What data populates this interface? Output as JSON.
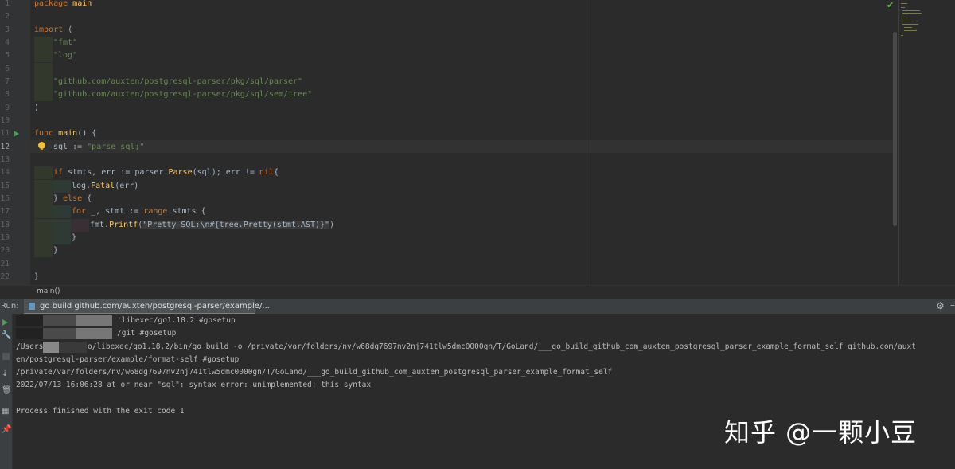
{
  "editor": {
    "line_numbers": [
      "1",
      "2",
      "3",
      "4",
      "5",
      "6",
      "7",
      "8",
      "9",
      "10",
      "11",
      "12",
      "13",
      "14",
      "15",
      "16",
      "17",
      "18",
      "19",
      "20",
      "21",
      "22"
    ],
    "lines": {
      "l1_kw": "package",
      "l1_rest": " main",
      "l3_kw": "import",
      "l3_rest": " (",
      "l4": "\"fmt\"",
      "l5": "\"log\"",
      "l7": "\"github.com/auxten/postgresql-parser/pkg/sql/parser\"",
      "l8": "\"github.com/auxten/postgresql-parser/pkg/sql/sem/tree\"",
      "l9": ")",
      "l11_kw": "func",
      "l11_fn": " main",
      "l11_rest": "() {",
      "l12_a": "sql := ",
      "l12_str": "\"parse sql;\"",
      "l14_kw": "if",
      "l14_a": " stmts, err := parser.",
      "l14_fn": "Parse",
      "l14_b": "(sql); err != ",
      "l14_nil": "nil",
      "l14_c": "{",
      "l15_a": "log.",
      "l15_fn": "Fatal",
      "l15_b": "(err)",
      "l16_a": "} ",
      "l16_kw": "else",
      "l16_b": " {",
      "l17_kw": "for",
      "l17_a": " _, stmt := ",
      "l17_kw2": "range",
      "l17_b": " stmts {",
      "l18_a": "fmt.",
      "l18_fn": "Printf",
      "l18_b": "(",
      "l18_str1": "\"Pretty SQL:\\n",
      "l18_fmt": "#{tree.Pretty(stmt.AST)}",
      "l18_str2": "\"",
      "l18_c": ")",
      "l19": "}",
      "l20": "}",
      "l22": "}"
    },
    "breadcrumb": "main()"
  },
  "run_panel": {
    "label": "Run:",
    "tab_title": "go build github.com/auxten/postgresql-parser/example/...",
    "toolbar_icons": [
      "rerun-icon",
      "wrench-icon",
      "stop-icon",
      "scroll-icon",
      "trash-icon",
      "layout-icon",
      "pin-icon"
    ],
    "console": [
      "'libexec/go1.18.2 #gosetup",
      "/git #gosetup",
      "/Users",
      "o/libexec/go1.18.2/bin/go build -o /private/var/folders/nv/w68dg7697nv2nj741tlw5dmc0000gn/T/GoLand/___go_build_github_com_auxten_postgresql_parser_example_format_self github.com/auxt",
      "en/postgresql-parser/example/format-self #gosetup",
      "/private/var/folders/nv/w68dg7697nv2nj741tlw5dmc0000gn/T/GoLand/___go_build_github_com_auxten_postgresql_parser_example_format_self",
      "2022/07/13 16:06:28 at or near \"sql\": syntax error: unimplemented: this syntax",
      "Process finished with the exit code 1"
    ]
  },
  "watermark": "知乎 @一颗小豆",
  "colors": {
    "keyword": "#cc7832",
    "string": "#6a8759",
    "function": "#ffc66d",
    "accent": "#4a88c7"
  }
}
